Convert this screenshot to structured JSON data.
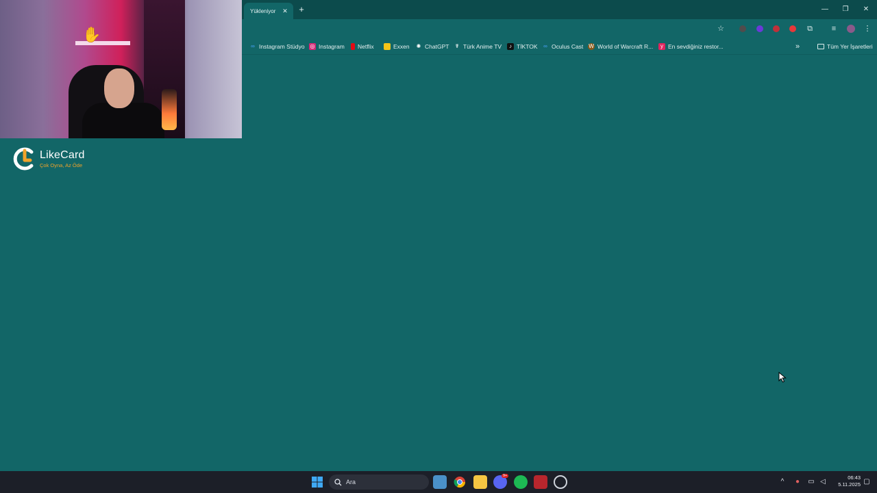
{
  "browser": {
    "tab": {
      "title": "Yükleniyor",
      "close_icon": "close-icon"
    },
    "new_tab_icon": "plus-icon",
    "window_controls": [
      "minimize-icon",
      "restore-icon",
      "close-icon"
    ],
    "accent_color": "#126667"
  },
  "bookmarks": {
    "items": [
      {
        "label": "Instagram Stüdyo",
        "icon": "meta-icon",
        "color": "#3b82f6"
      },
      {
        "label": "Instagram",
        "icon": "instagram-icon",
        "color": "#d62976"
      },
      {
        "label": "Netflix",
        "icon": "netflix-icon",
        "color": "#e50914"
      },
      {
        "label": "Exxen",
        "icon": "exxen-icon",
        "color": "#f5c518"
      },
      {
        "label": "ChatGPT",
        "icon": "chatgpt-icon",
        "color": "#dfeeee"
      },
      {
        "label": "Türk Anime TV",
        "icon": "anime-icon",
        "color": "#dfeeee"
      },
      {
        "label": "TİKTOK",
        "icon": "tiktok-icon",
        "color": "#111111"
      },
      {
        "label": "Oculus Cast",
        "icon": "meta-icon",
        "color": "#3b82f6"
      },
      {
        "label": "World of Warcraft R...",
        "icon": "wow-icon",
        "color": "#8b5a1a"
      },
      {
        "label": "En sevdiğiniz restor...",
        "icon": "yemeksepeti-icon",
        "color": "#e0245e"
      }
    ],
    "all_bookmarks_label": "Tüm Yer İşaretleri"
  },
  "overlay": {
    "logo_name": "LikeCard",
    "logo_tagline": "Çok Oyna, Az Öde",
    "logo_colors": {
      "primary": "#ffffff",
      "accent": "#f0a32a"
    }
  },
  "taskbar": {
    "search_placeholder": "Ara",
    "time": "06:43",
    "date": "5.11.2025",
    "discord_badge": "9+"
  }
}
